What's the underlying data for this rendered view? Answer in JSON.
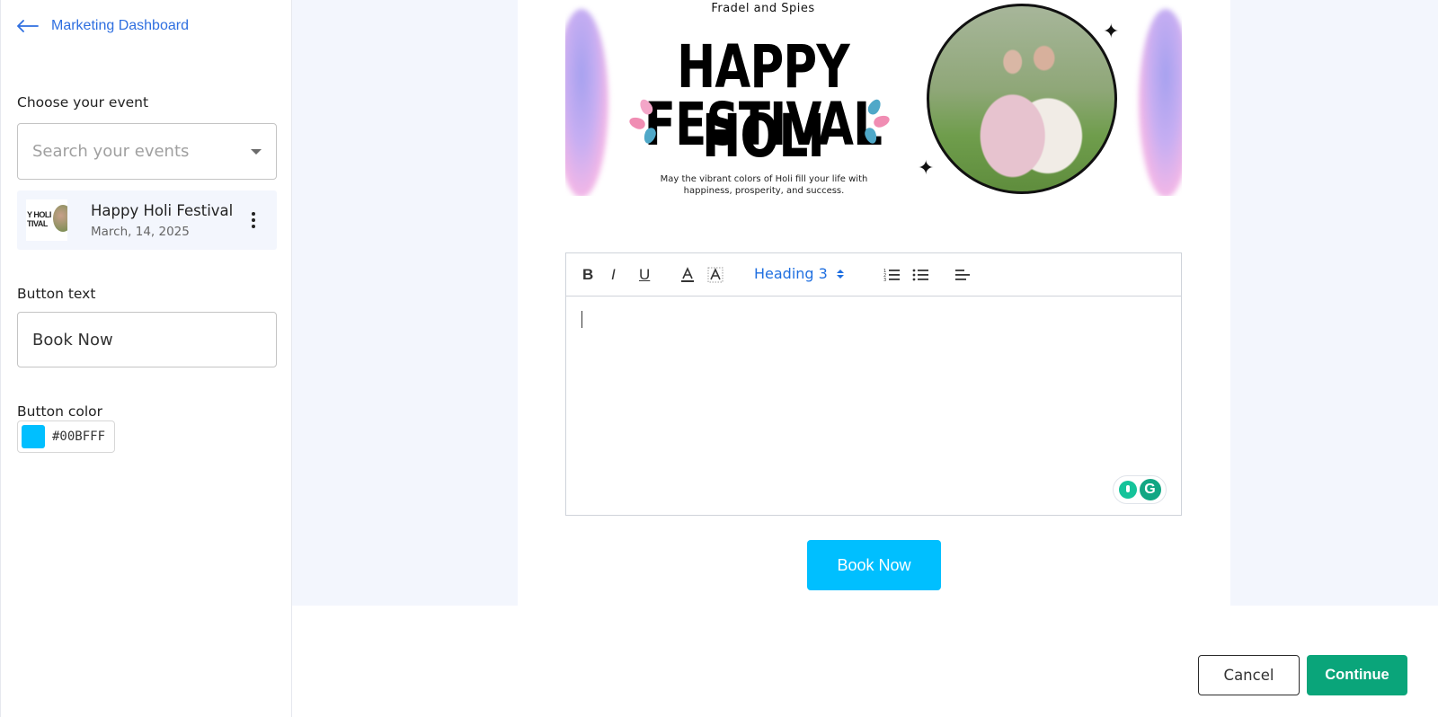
{
  "nav": {
    "back_label": "Marketing Dashboard"
  },
  "sidebar": {
    "event_section_label": "Choose your event",
    "search_placeholder": "Search your events",
    "selected_event": {
      "title": "Happy Holi Festival",
      "date": "March, 14, 2025",
      "thumb_text_line1": "Y HOLI",
      "thumb_text_line2": "TIVAL"
    },
    "button_text_label": "Button text",
    "button_text_value": "Book Now",
    "button_color_label": "Button color",
    "button_color_value": "#00BFFF"
  },
  "banner": {
    "brand": "Fradel and Spies",
    "headline_line1": "HAPPY HOLI",
    "headline_line2": "FESTIVAL",
    "tagline": "May the vibrant colors of Holi fill your life with happiness, prosperity, and success."
  },
  "editor": {
    "toolbar": {
      "bold": "B",
      "italic": "I",
      "underline": "U",
      "heading_select": "Heading 3"
    }
  },
  "cta": {
    "label": "Book Now",
    "color": "#00BFFF"
  },
  "footer": {
    "cancel_label": "Cancel",
    "continue_label": "Continue",
    "continue_color": "#0aa57a"
  },
  "colors": {
    "link": "#2f6fe0",
    "page_bg": "#f3f6fd",
    "selected_card_bg": "#f3f6fd"
  }
}
